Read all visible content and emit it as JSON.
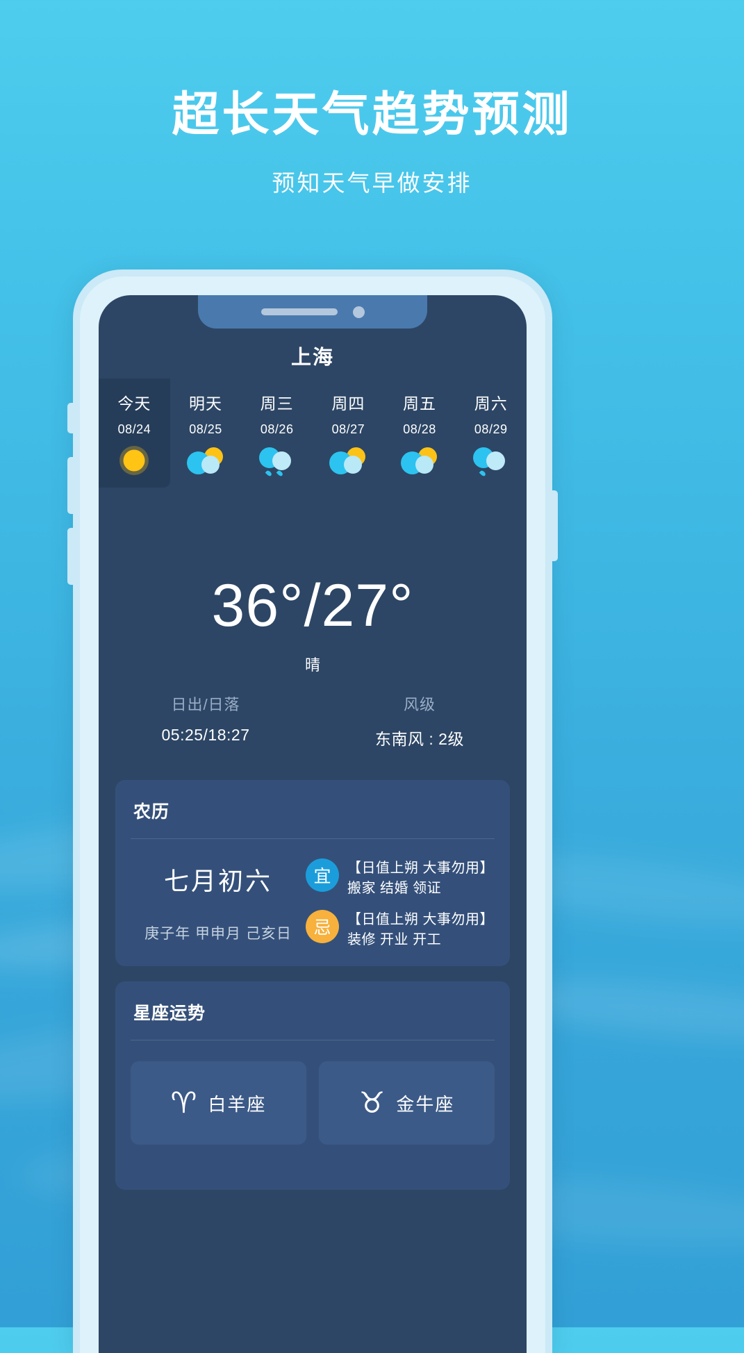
{
  "promo": {
    "headline": "超长天气趋势预测",
    "subheadline": "预知天气早做安排"
  },
  "phone": {
    "city": "上海",
    "forecast_days": [
      {
        "name": "今天",
        "date": "08/24",
        "icon": "sunny-icon",
        "active": true
      },
      {
        "name": "明天",
        "date": "08/25",
        "icon": "partly-cloudy-icon",
        "active": false
      },
      {
        "name": "周三",
        "date": "08/26",
        "icon": "rain-icon",
        "active": false
      },
      {
        "name": "周四",
        "date": "08/27",
        "icon": "partly-cloudy-icon",
        "active": false
      },
      {
        "name": "周五",
        "date": "08/28",
        "icon": "partly-cloudy-icon",
        "active": false
      },
      {
        "name": "周六",
        "date": "08/29",
        "icon": "rain-icon",
        "active": false
      }
    ],
    "current": {
      "temperature_range": "36°/27°",
      "condition": "晴",
      "sun_label": "日出/日落",
      "sun_value": "05:25/18:27",
      "wind_label": "风级",
      "wind_value": "东南风 : 2级"
    },
    "lunar_card": {
      "title": "农历",
      "lunar_day": "七月初六",
      "ganzhi": "庚子年 甲申月 己亥日",
      "yi": {
        "badge": "宜",
        "text": "【日值上朔 大事勿用】 搬家 结婚 领证",
        "color": "#1c9ddb"
      },
      "ji": {
        "badge": "忌",
        "text": "【日值上朔 大事勿用】 装修 开业 开工",
        "color": "#f7b13c"
      }
    },
    "zodiac_card": {
      "title": "星座运势",
      "items": [
        {
          "glyph": "♈",
          "name": "白羊座"
        },
        {
          "glyph": "♉",
          "name": "金牛座"
        }
      ]
    }
  },
  "colors": {
    "background_top": "#4fcdee",
    "background_bottom": "#32a0d6",
    "phone_bezel": "#cbe9f6",
    "screen_bg": "#2d4665",
    "card_bg": "#34507a",
    "sun_yellow": "#ffc414",
    "cloud_blue": "#2cc3f0"
  }
}
